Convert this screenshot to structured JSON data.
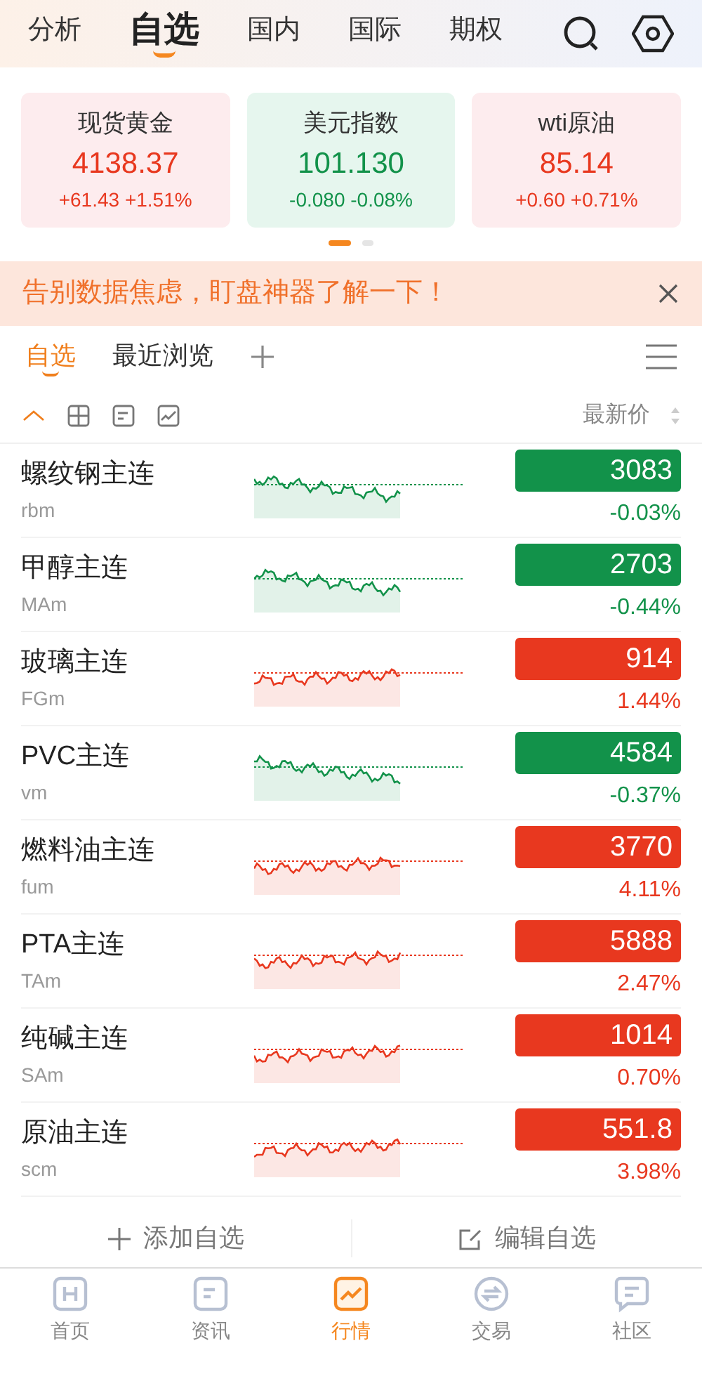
{
  "top_tabs": [
    {
      "label": "分析",
      "selected": false
    },
    {
      "label": "自选",
      "selected": true
    },
    {
      "label": "国内",
      "selected": false
    },
    {
      "label": "国际",
      "selected": false
    },
    {
      "label": "期权",
      "selected": false
    }
  ],
  "index_cards": [
    {
      "name": "现货黄金",
      "price": "4138.37",
      "change": "+61.43 +1.51%",
      "rising": true
    },
    {
      "name": "美元指数",
      "price": "101.130",
      "change": "-0.080 -0.08%",
      "rising": false
    },
    {
      "name": "wti原油",
      "price": "85.14",
      "change": "+0.60 +0.71%",
      "rising": true
    }
  ],
  "pager": [
    {
      "selected": true
    },
    {
      "selected": false
    }
  ],
  "banner": {
    "text": "告别数据焦虑，盯盘神器了解一下！"
  },
  "list_tabs": [
    {
      "label": "自选",
      "selected": true
    },
    {
      "label": "最近浏览",
      "selected": false
    }
  ],
  "view_modes": [
    {
      "kind": "line",
      "selected": true
    },
    {
      "kind": "grid",
      "selected": false
    },
    {
      "kind": "note",
      "selected": false
    },
    {
      "kind": "chart",
      "selected": false
    }
  ],
  "sort_label": "最新价",
  "rows": [
    {
      "name": "螺纹钢主连",
      "code": "rbm",
      "price": "3083",
      "change": "-0.03%",
      "rising": false
    },
    {
      "name": "甲醇主连",
      "code": "MAm",
      "price": "2703",
      "change": "-0.44%",
      "rising": false
    },
    {
      "name": "玻璃主连",
      "code": "FGm",
      "price": "914",
      "change": "1.44%",
      "rising": true
    },
    {
      "name": "PVC主连",
      "code": "vm",
      "price": "4584",
      "change": "-0.37%",
      "rising": false
    },
    {
      "name": "燃料油主连",
      "code": "fum",
      "price": "3770",
      "change": "4.11%",
      "rising": true
    },
    {
      "name": "PTA主连",
      "code": "TAm",
      "price": "5888",
      "change": "2.47%",
      "rising": true
    },
    {
      "name": "纯碱主连",
      "code": "SAm",
      "price": "1014",
      "change": "0.70%",
      "rising": true
    },
    {
      "name": "原油主连",
      "code": "scm",
      "price": "551.8",
      "change": "3.98%",
      "rising": true
    }
  ],
  "footer_actions": [
    "添加自选",
    "编辑自选"
  ],
  "bottom_nav": [
    {
      "label": "首页",
      "selected": false
    },
    {
      "label": "资讯",
      "selected": false
    },
    {
      "label": "行情",
      "selected": true
    },
    {
      "label": "交易",
      "selected": false
    },
    {
      "label": "社区",
      "selected": false
    }
  ]
}
